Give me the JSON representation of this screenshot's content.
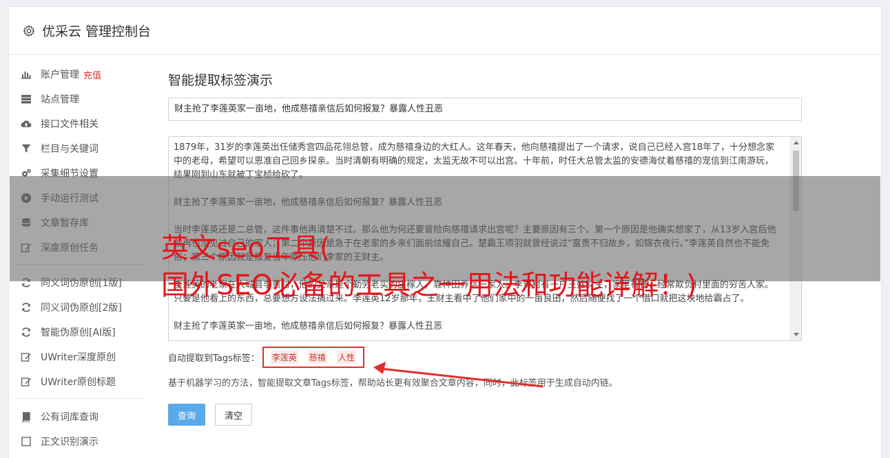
{
  "header": {
    "title": "优采云 管理控制台",
    "icon": "gear-icon"
  },
  "sidebar": {
    "group1": [
      {
        "label": "账户管理",
        "badge": "充值",
        "icon": "bar-chart-icon"
      },
      {
        "label": "站点管理",
        "icon": "server-icon"
      },
      {
        "label": "接口文件相关",
        "icon": "cloud-upload-icon"
      },
      {
        "label": "栏目与关键词",
        "icon": "filter-icon"
      },
      {
        "label": "采集细节设置",
        "icon": "gears-icon"
      },
      {
        "label": "手动运行测试",
        "icon": "play-circle-icon"
      },
      {
        "label": "文章暂存库",
        "icon": "database-icon"
      },
      {
        "label": "深度原创任务",
        "icon": "edit-icon"
      }
    ],
    "group2": [
      {
        "label": "同义词伪原创[1版]",
        "icon": "refresh-icon"
      },
      {
        "label": "同义词伪原创[2版]",
        "icon": "refresh-icon"
      },
      {
        "label": "智能伪原创[AI版]",
        "icon": "refresh-icon"
      },
      {
        "label": "UWriter深度原创",
        "icon": "edit-icon"
      },
      {
        "label": "UWriter原创标题",
        "icon": "edit-icon"
      }
    ],
    "group3": [
      {
        "label": "公有词库查询",
        "icon": "book-icon"
      },
      {
        "label": "正文识别演示",
        "icon": "square-icon"
      }
    ]
  },
  "main": {
    "heading": "智能提取标签演示",
    "title_value": "财主抢了李莲英家一亩地，他成慈禧亲信后如何报复？暴露人性丑恶",
    "article_paragraphs": [
      "1879年，31岁的李莲英出任储秀宫四品花翎总管，成为慈禧身边的大红人。这年春天，他向慈禧提出了一个请求，说自己已经入宫18年了，十分想念家中的老母，希望可以恩准自己回乡探亲。当时清朝有明确的规定，太监无故不可以出宫。十年前，时任大总管太监的安德海仗着慈禧的宠信到江南游玩，结果刚到山东就被丁宝桢给砍了。",
      "财主抢了李莲英家一亩地，他成慈禧亲信后如何报复？暴露人性丑恶",
      "当时李莲英还是二总管，这件事他再清楚不过。那么他为何还要冒险向慈禧请求出宫呢？主要原因有三个。第一个原因是他确实想家了，从13岁入宫后他就再也没见过自己的家人；第二个原因是急于在老家的乡亲们面前炫耀自己。楚霸王项羽就曾经说过“富贵不归故乡，如锦衣夜行。”李莲英自然也不能免俗；第三个原因就是报复当年欺压他们李家的王财主。",
      "李莲英的老家在大城县李贾村，他的父亲是个勤劳老实的庄稼人，靠种田养活一家人。李贾村有一户王姓财主，家里有钱，经常欺负村里面的穷苦人家。只要是他看上的东西，总要想方设法搞过来。李莲英12岁那年，王财主看中了他们家中的一亩良田，然后随便找了一个借口就把这块地给霸占了。",
      "财主抢了李莲英家一亩地，他成慈禧亲信后如何报复？暴露人性丑恶"
    ],
    "tags_label": "自动提取到Tags标签：",
    "tags": [
      "李莲英",
      "慈禧",
      "人性"
    ],
    "description": "基于机器学习的方法，智能提取文章Tags标签，帮助站长更有效聚合文章内容，同时，此标签用于生成自动内链。",
    "query_button": "查询",
    "clear_button": "清空"
  },
  "overlay": {
    "line1": "英文seo工具(",
    "line2": "国外SEO必备的工具之一用法和功能详解！)"
  },
  "colors": {
    "accent": "#5aa9e8",
    "highlight_red": "#e02d2d",
    "overlay_red": "#e5141b"
  }
}
